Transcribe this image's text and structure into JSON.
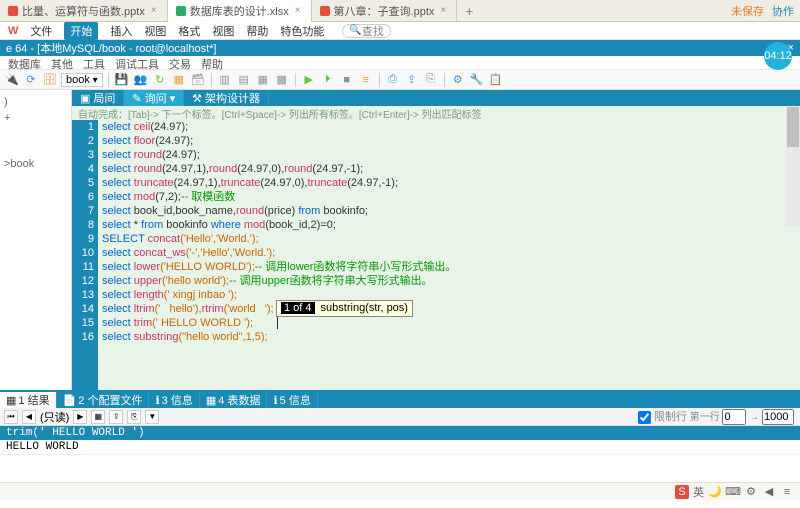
{
  "browserTabs": [
    {
      "label": "比量、运算符与函数.pptx",
      "icon": "#e74c3c"
    },
    {
      "label": "数据库表的设计.xlsx",
      "icon": "#27ae60"
    },
    {
      "label": "第八章：子查询.pptx",
      "icon": "#e74c3c"
    }
  ],
  "sync": {
    "unsync": "未保存",
    "collab": "协作"
  },
  "menus": [
    "文件",
    "开始",
    "插入",
    "视图",
    "格式",
    "视图",
    "帮助",
    "特色功能"
  ],
  "searchPlaceholder": "查找",
  "title": "e 64 - [本地MySQL/book - root@localhost*]",
  "wpsMenus": [
    "数据库",
    "其他",
    "工具",
    "调试工具",
    "交易",
    "帮助"
  ],
  "dbSel": "book",
  "timer": "04:12",
  "sidebar": [
    ")",
    "+",
    "",
    ">book"
  ],
  "edTabs": [
    {
      "label": "局间"
    },
    {
      "label": "询问",
      "active": true
    },
    {
      "label": "架构设计器"
    }
  ],
  "hint": "自动完成：[Tab]-> 下一个标签。[Ctrl+Space]-> 列出所有标签。[Ctrl+Enter]-> 列出匹配标签",
  "lines": [
    "1",
    "2",
    "3",
    "4",
    "5",
    "6",
    "7",
    "8",
    "9",
    "10",
    "11",
    "12",
    "13",
    "14",
    "15",
    "16"
  ],
  "code": {
    "l1": {
      "a": "select",
      "b": " ceil",
      "c": "(24.97);"
    },
    "l2": {
      "a": "select",
      "b": " floor",
      "c": "(24.97);"
    },
    "l3": {
      "a": "select",
      "b": " round",
      "c": "(24.97);"
    },
    "l4": {
      "a": "select",
      "b": " round",
      "c": "(24.97,1),",
      "d": "round",
      "e": "(24.97,0),",
      "f": "round",
      "g": "(24.97,-1);"
    },
    "l5": {
      "a": "select",
      "b": " truncate",
      "c": "(24.97,1),",
      "d": "truncate",
      "e": "(24.97,0),",
      "f": "truncate",
      "g": "(24.97,-1);"
    },
    "l6": {
      "a": "select",
      "b": " mod",
      "c": "(7,2);",
      "d": "-- 取模函数"
    },
    "l7": {
      "a": "select",
      "b": " book_id,book_name,",
      "c": "round",
      "d": "(price) ",
      "e": "from",
      "f": " bookinfo;"
    },
    "l8": {
      "a": "select",
      "b": " * ",
      "c": "from",
      "d": " bookinfo ",
      "e": "where",
      "f": " mod",
      "g": "(book_id,2)=0;"
    },
    "l9": {
      "a": "SELECT",
      "b": " concat",
      "c": "('Hello','World.');"
    },
    "l10": {
      "a": "select",
      "b": " concat_ws",
      "c": "('-','Hello','World.');"
    },
    "l11": {
      "a": "select",
      "b": " lower",
      "c": "('HELLO WORLD');",
      "d": "-- 调用lower函数将字符串小写形式输出。"
    },
    "l12": {
      "a": "select",
      "b": " upper",
      "c": "('hello world');",
      "d": "-- 调用upper函数将字符串大写形式输出。"
    },
    "l13": {
      "a": "select",
      "b": " length",
      "c": "(' xingj inbao ');"
    },
    "l14": {
      "a": "select",
      "b": " ltrim",
      "c": "('   hello'),",
      "d": "rtrim",
      "e": "('world   ');"
    },
    "l15": {
      "a": "select",
      "b": " trim",
      "c": "(' HELLO WORLD ');"
    },
    "l16": {
      "a": "select",
      "b": " substring",
      "c": "(\"hello world\",1,5);"
    }
  },
  "tooltip": {
    "count": "1 of 4",
    "sig": "substring(str, pos)"
  },
  "resTabs": [
    {
      "label": "1 结果",
      "active": true
    },
    {
      "label": "2 个配置文件",
      "active": false
    },
    {
      "label": "3 信息",
      "active": false
    },
    {
      "label": "4 表数据",
      "active": false
    },
    {
      "label": "5 信息",
      "active": false
    }
  ],
  "resBar": {
    "readonly": "(只读)"
  },
  "resHead": "trim(' HELLO WORLD ')",
  "resRow": "HELLO WORLD",
  "limit": {
    "label": "限制行",
    "range": "0 → 1000"
  },
  "status": {
    "ime": "英"
  }
}
